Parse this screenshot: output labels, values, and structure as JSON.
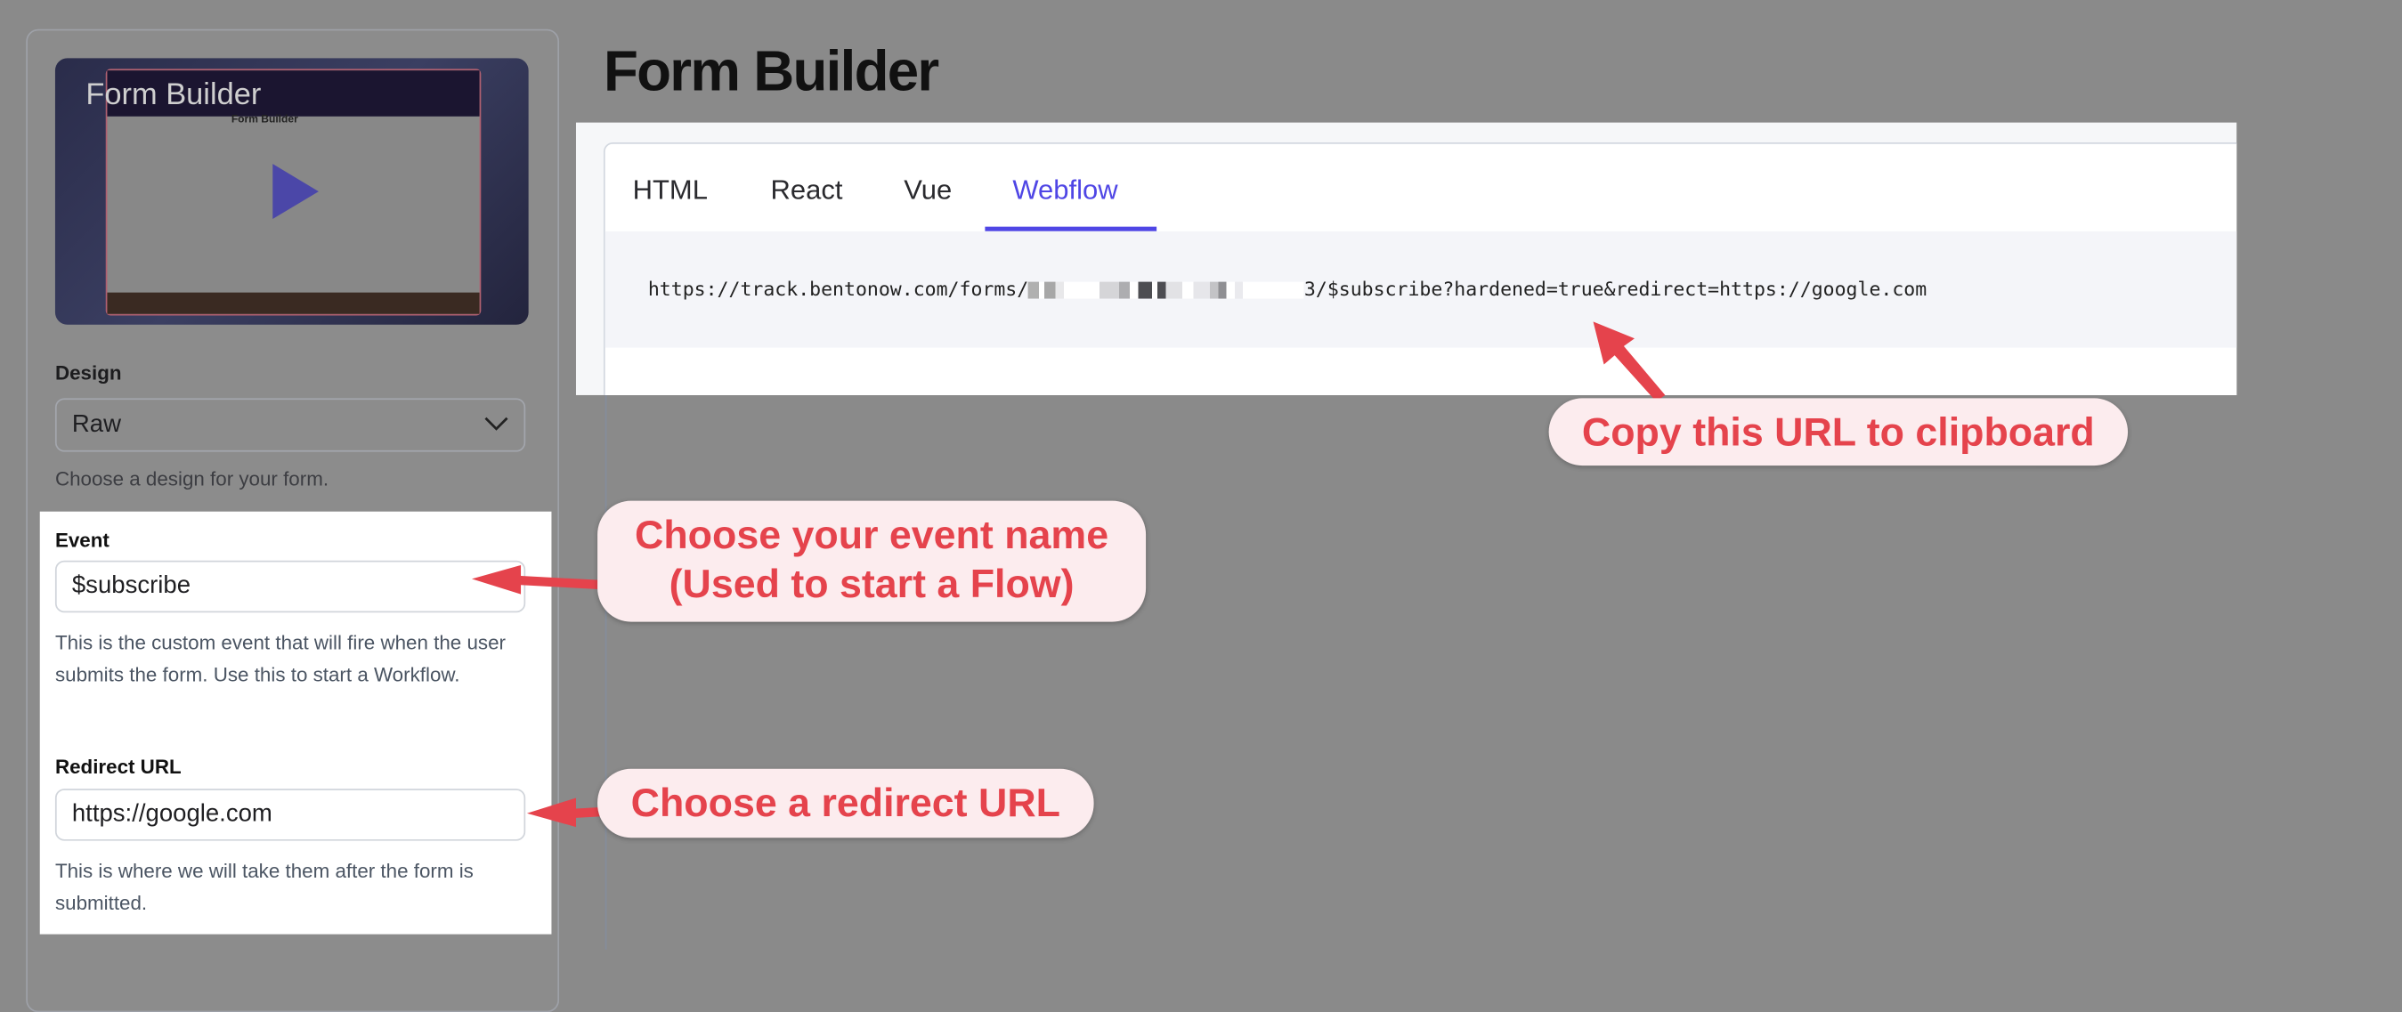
{
  "sidebar": {
    "video": {
      "title": "Form Builder",
      "inner_title": "Form Builder",
      "play_icon": "play-icon"
    },
    "design": {
      "label": "Design",
      "value": "Raw",
      "help": "Choose a design for your form."
    },
    "event": {
      "label": "Event",
      "value": "$subscribe",
      "help": "This is the custom event that will fire when the user submits the form. Use this to start a Workflow."
    },
    "redirect": {
      "label": "Redirect URL",
      "value": "https://google.com",
      "help": "This is where we will take them after the form is submitted."
    }
  },
  "main": {
    "title": "Form Builder",
    "tabs": [
      {
        "label": "HTML",
        "active": false
      },
      {
        "label": "React",
        "active": false
      },
      {
        "label": "Vue",
        "active": false
      },
      {
        "label": "Webflow",
        "active": true
      }
    ],
    "url_prefix": "https://track.bentonow.com/forms/",
    "url_suffix": "3/$subscribe?hardened=true&redirect=https://google.com"
  },
  "annotations": {
    "copy": "Copy this URL to clipboard",
    "event_line1": "Choose your event name",
    "event_line2": "(Used to start a Flow)",
    "redirect": "Choose a redirect URL"
  },
  "colors": {
    "accent": "#4f46e5",
    "annotation": "#e5434c",
    "annotation_bg": "#fcecee",
    "overlay": "#8a8a8a"
  }
}
